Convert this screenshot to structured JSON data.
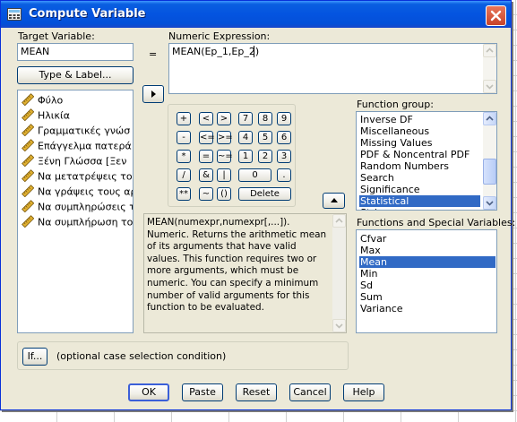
{
  "window": {
    "title": "Compute Variable"
  },
  "target": {
    "label": "Target Variable:",
    "value": "MEAN",
    "equals": "=",
    "type_label_button": "Type & Label..."
  },
  "expression": {
    "label": "Numeric Expression:",
    "value": "MEAN(Ep_1,Ep_2)"
  },
  "variables": [
    "Φύλο",
    "Ηλικία",
    "Γραμματικές   γνώσ",
    "Επάγγελμα πατερά [Ε",
    "Ξένη  Γλώσσα  [Ξεν",
    "Να μετατρέψεις το ε",
    "Να γράψεις τους αρι",
    "Να συμπληρώσεις το",
    "Να συμπλήρωση το"
  ],
  "keypad": {
    "row1": [
      "+",
      "<",
      ">",
      "7",
      "8",
      "9"
    ],
    "row2": [
      "-",
      "<=",
      ">=",
      "4",
      "5",
      "6"
    ],
    "row3": [
      "*",
      "=",
      "~=",
      "1",
      "2",
      "3"
    ],
    "row4": [
      "/",
      "&",
      "|",
      "0",
      "."
    ],
    "row5": [
      "**",
      "~",
      "()",
      "Delete"
    ]
  },
  "description": "MEAN(numexpr,numexpr[,...]). Numeric. Returns the arithmetic mean of its arguments that have valid values. This function requires two or more arguments, which must be numeric. You can specify a minimum number of valid arguments for this function to be evaluated.",
  "function_group": {
    "label": "Function group:",
    "items": [
      "Inverse DF",
      "Miscellaneous",
      "Missing Values",
      "PDF & Noncentral PDF",
      "Random Numbers",
      "Search",
      "Significance",
      "Statistical",
      "String"
    ],
    "selected": "Statistical"
  },
  "functions": {
    "label": "Functions and Special Variables:",
    "items": [
      "Cfvar",
      "Max",
      "Mean",
      "Min",
      "Sd",
      "Sum",
      "Variance"
    ],
    "selected": "Mean"
  },
  "if_section": {
    "button": "If...",
    "text": "(optional case selection condition)"
  },
  "footer": {
    "ok": "OK",
    "paste": "Paste",
    "reset": "Reset",
    "cancel": "Cancel",
    "help": "Help"
  },
  "colors": {
    "titlebar": "#0454e0",
    "selection": "#316ac5",
    "dialog_bg": "#ece9d8",
    "ruler_icon": "#e0b030"
  },
  "icons": {
    "ruler": "ruler-icon",
    "close": "close-icon",
    "arrow_right": "arrow-right-icon",
    "arrow_up": "arrow-up-icon"
  }
}
